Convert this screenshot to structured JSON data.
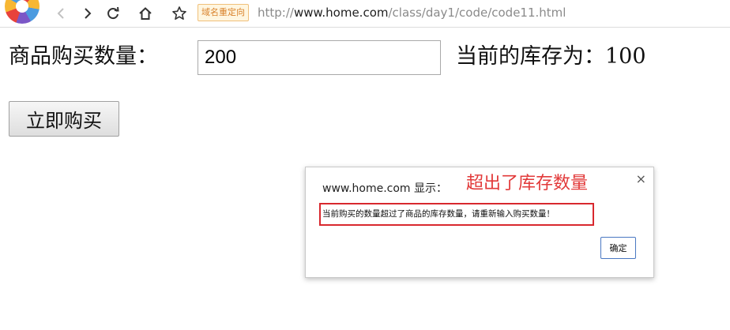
{
  "browser": {
    "redirect_badge": "域名重定向",
    "url_prefix": "http://",
    "url_host": "www.home.com",
    "url_path": "/class/day1/code/code11.html",
    "icons": [
      "back-icon",
      "forward-icon",
      "reload-icon",
      "home-icon",
      "star-icon"
    ]
  },
  "page": {
    "quantity_label": "商品购买数量：",
    "quantity_value": "200",
    "stock_text": "当前的库存为：100",
    "buy_button": "立即购买"
  },
  "dialog": {
    "title": "www.home.com 显示：",
    "annotation": "超出了库存数量",
    "message": "当前购买的数量超过了商品的库存数量，请重新输入购买数量！",
    "ok_button": "确定",
    "close_symbol": "×"
  },
  "colors": {
    "annotation_red": "#e23a3a",
    "highlight_border": "#d8282e",
    "ok_button_border": "#4a78c2"
  }
}
